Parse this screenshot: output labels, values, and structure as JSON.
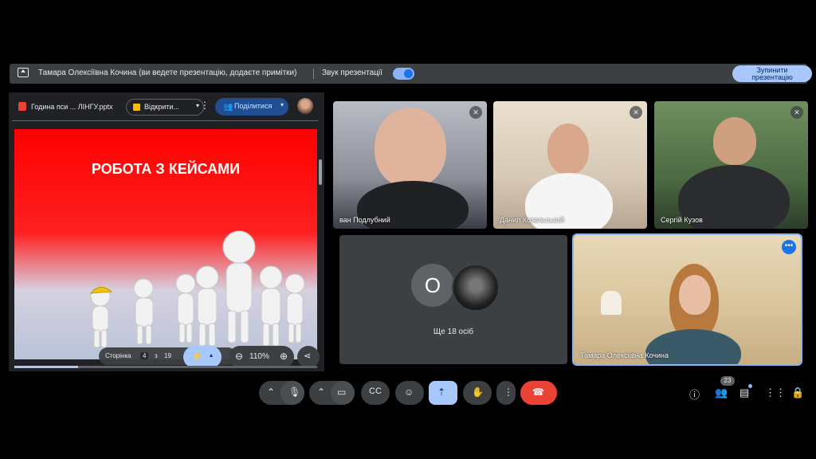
{
  "banner": {
    "text": "Тамара Олексіївна Кочина (ви ведете презентацію, додаєте примітки)",
    "sound_label": "Звук презентації",
    "stop_button": "Зупинити презентацію"
  },
  "slides_panel": {
    "file_name": "Година пси ... ЛІНГУ.pptx",
    "open_button": "Відкрити...",
    "share_button": "Поділитися",
    "slide_title": "РОБОТА З КЕЙСАМИ",
    "page_label": "Сторінка",
    "current_page": "4",
    "of_label": "з",
    "total_pages": "19",
    "zoom": "110%",
    "progress_fraction": 0.21
  },
  "participants": [
    {
      "name": "ван Подлубний",
      "muted": true
    },
    {
      "name": "Данил Козельський",
      "muted": true
    },
    {
      "name": "Сергій Кузов",
      "muted": true
    }
  ],
  "others_tile": {
    "initial": "О",
    "label": "Ще 18 осіб"
  },
  "presenter_tile": {
    "name": "Тамара Олексіївна Кочина"
  },
  "bottom_bar": {
    "participant_count": "23"
  },
  "colors": {
    "accent": "#a8c7fa",
    "end_call": "#ea4335",
    "tile_bg": "#3c4043"
  }
}
